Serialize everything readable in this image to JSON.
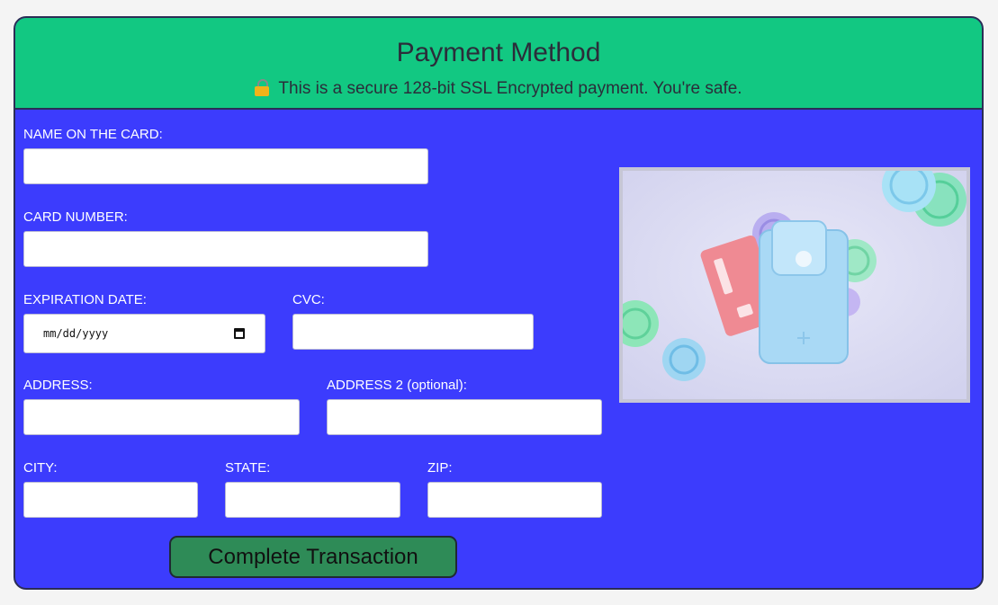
{
  "header": {
    "title": "Payment Method",
    "subtitle": "This is a secure 128-bit SSL Encrypted payment. You're safe."
  },
  "form": {
    "name_label": "NAME ON THE CARD:",
    "card_number_label": "CARD NUMBER:",
    "expiration_label": "EXPIRATION DATE:",
    "expiration_placeholder": "mm/dd/yyyy",
    "cvc_label": "CVC:",
    "address_label": "ADDRESS:",
    "address2_label": "ADDRESS 2 (optional):",
    "city_label": "CITY:",
    "state_label": "STATE:",
    "zip_label": "ZIP:",
    "submit_label": "Complete Transaction"
  },
  "icons": {
    "lock": "lock-icon",
    "calendar": "calendar-icon"
  },
  "colors": {
    "header_bg": "#12c882",
    "form_bg": "#3c3cfd",
    "button_bg": "#2e8b57"
  }
}
